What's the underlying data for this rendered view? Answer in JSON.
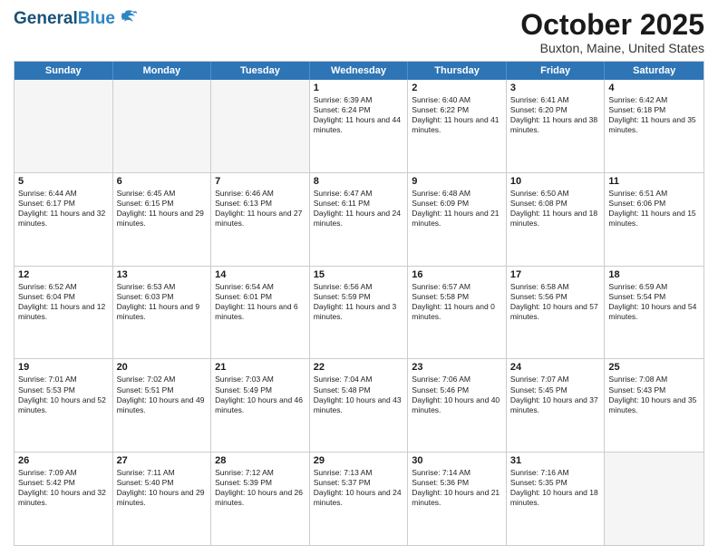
{
  "header": {
    "logo_general": "General",
    "logo_blue": "Blue",
    "month_title": "October 2025",
    "location": "Buxton, Maine, United States"
  },
  "days_of_week": [
    "Sunday",
    "Monday",
    "Tuesday",
    "Wednesday",
    "Thursday",
    "Friday",
    "Saturday"
  ],
  "weeks": [
    [
      {
        "day": "",
        "text": ""
      },
      {
        "day": "",
        "text": ""
      },
      {
        "day": "",
        "text": ""
      },
      {
        "day": "1",
        "text": "Sunrise: 6:39 AM\nSunset: 6:24 PM\nDaylight: 11 hours and 44 minutes."
      },
      {
        "day": "2",
        "text": "Sunrise: 6:40 AM\nSunset: 6:22 PM\nDaylight: 11 hours and 41 minutes."
      },
      {
        "day": "3",
        "text": "Sunrise: 6:41 AM\nSunset: 6:20 PM\nDaylight: 11 hours and 38 minutes."
      },
      {
        "day": "4",
        "text": "Sunrise: 6:42 AM\nSunset: 6:18 PM\nDaylight: 11 hours and 35 minutes."
      }
    ],
    [
      {
        "day": "5",
        "text": "Sunrise: 6:44 AM\nSunset: 6:17 PM\nDaylight: 11 hours and 32 minutes."
      },
      {
        "day": "6",
        "text": "Sunrise: 6:45 AM\nSunset: 6:15 PM\nDaylight: 11 hours and 29 minutes."
      },
      {
        "day": "7",
        "text": "Sunrise: 6:46 AM\nSunset: 6:13 PM\nDaylight: 11 hours and 27 minutes."
      },
      {
        "day": "8",
        "text": "Sunrise: 6:47 AM\nSunset: 6:11 PM\nDaylight: 11 hours and 24 minutes."
      },
      {
        "day": "9",
        "text": "Sunrise: 6:48 AM\nSunset: 6:09 PM\nDaylight: 11 hours and 21 minutes."
      },
      {
        "day": "10",
        "text": "Sunrise: 6:50 AM\nSunset: 6:08 PM\nDaylight: 11 hours and 18 minutes."
      },
      {
        "day": "11",
        "text": "Sunrise: 6:51 AM\nSunset: 6:06 PM\nDaylight: 11 hours and 15 minutes."
      }
    ],
    [
      {
        "day": "12",
        "text": "Sunrise: 6:52 AM\nSunset: 6:04 PM\nDaylight: 11 hours and 12 minutes."
      },
      {
        "day": "13",
        "text": "Sunrise: 6:53 AM\nSunset: 6:03 PM\nDaylight: 11 hours and 9 minutes."
      },
      {
        "day": "14",
        "text": "Sunrise: 6:54 AM\nSunset: 6:01 PM\nDaylight: 11 hours and 6 minutes."
      },
      {
        "day": "15",
        "text": "Sunrise: 6:56 AM\nSunset: 5:59 PM\nDaylight: 11 hours and 3 minutes."
      },
      {
        "day": "16",
        "text": "Sunrise: 6:57 AM\nSunset: 5:58 PM\nDaylight: 11 hours and 0 minutes."
      },
      {
        "day": "17",
        "text": "Sunrise: 6:58 AM\nSunset: 5:56 PM\nDaylight: 10 hours and 57 minutes."
      },
      {
        "day": "18",
        "text": "Sunrise: 6:59 AM\nSunset: 5:54 PM\nDaylight: 10 hours and 54 minutes."
      }
    ],
    [
      {
        "day": "19",
        "text": "Sunrise: 7:01 AM\nSunset: 5:53 PM\nDaylight: 10 hours and 52 minutes."
      },
      {
        "day": "20",
        "text": "Sunrise: 7:02 AM\nSunset: 5:51 PM\nDaylight: 10 hours and 49 minutes."
      },
      {
        "day": "21",
        "text": "Sunrise: 7:03 AM\nSunset: 5:49 PM\nDaylight: 10 hours and 46 minutes."
      },
      {
        "day": "22",
        "text": "Sunrise: 7:04 AM\nSunset: 5:48 PM\nDaylight: 10 hours and 43 minutes."
      },
      {
        "day": "23",
        "text": "Sunrise: 7:06 AM\nSunset: 5:46 PM\nDaylight: 10 hours and 40 minutes."
      },
      {
        "day": "24",
        "text": "Sunrise: 7:07 AM\nSunset: 5:45 PM\nDaylight: 10 hours and 37 minutes."
      },
      {
        "day": "25",
        "text": "Sunrise: 7:08 AM\nSunset: 5:43 PM\nDaylight: 10 hours and 35 minutes."
      }
    ],
    [
      {
        "day": "26",
        "text": "Sunrise: 7:09 AM\nSunset: 5:42 PM\nDaylight: 10 hours and 32 minutes."
      },
      {
        "day": "27",
        "text": "Sunrise: 7:11 AM\nSunset: 5:40 PM\nDaylight: 10 hours and 29 minutes."
      },
      {
        "day": "28",
        "text": "Sunrise: 7:12 AM\nSunset: 5:39 PM\nDaylight: 10 hours and 26 minutes."
      },
      {
        "day": "29",
        "text": "Sunrise: 7:13 AM\nSunset: 5:37 PM\nDaylight: 10 hours and 24 minutes."
      },
      {
        "day": "30",
        "text": "Sunrise: 7:14 AM\nSunset: 5:36 PM\nDaylight: 10 hours and 21 minutes."
      },
      {
        "day": "31",
        "text": "Sunrise: 7:16 AM\nSunset: 5:35 PM\nDaylight: 10 hours and 18 minutes."
      },
      {
        "day": "",
        "text": ""
      }
    ]
  ]
}
